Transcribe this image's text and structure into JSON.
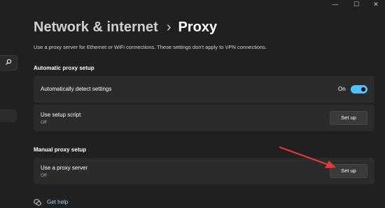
{
  "window": {
    "min_glyph": "—",
    "max_glyph": "☐",
    "close_glyph": "✕"
  },
  "breadcrumb": {
    "parent": "Network & internet",
    "separator": "›",
    "current": "Proxy"
  },
  "description": "Use a proxy server for Ethernet or WiFi connections. These settings don't apply to VPN connections.",
  "automatic": {
    "title": "Automatic proxy setup",
    "detect": {
      "label": "Automatically detect settings",
      "state": "On",
      "on": true
    },
    "script": {
      "label": "Use setup script",
      "status": "Off",
      "button": "Set up"
    }
  },
  "manual": {
    "title": "Manual proxy setup",
    "server": {
      "label": "Use a proxy server",
      "status": "Off",
      "button": "Set up"
    }
  },
  "help": {
    "label": "Get help"
  },
  "colors": {
    "accent": "#4cc2ff",
    "annotation": "#e53935",
    "background": "#202020",
    "card": "#2b2b2b"
  }
}
